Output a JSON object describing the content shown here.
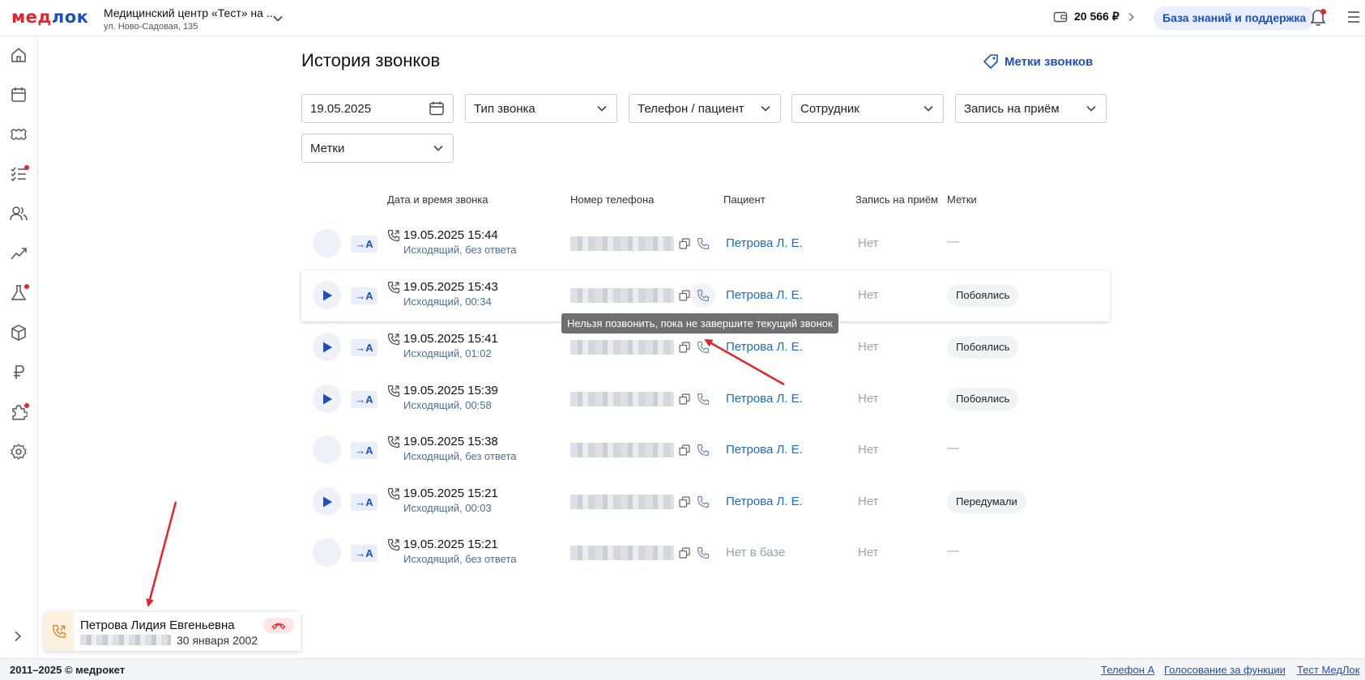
{
  "header": {
    "logo_red": "мед",
    "logo_blue": "лок",
    "clinic_name": "Медицинский центр «Тест» на ...",
    "clinic_address": "ул. Ново-Садовая, 135",
    "balance": "20 566 ₽",
    "kb_button": "База знаний и поддержка"
  },
  "sidebar": {
    "icons": [
      "home-icon",
      "calendar-icon",
      "teeth-icon",
      "tasks-icon",
      "people-icon",
      "chart-icon",
      "flask-icon",
      "box-icon",
      "ruble-icon",
      "puzzle-icon",
      "settings-icon"
    ],
    "notification_color": "#e3262d"
  },
  "page": {
    "title": "История звонков",
    "tags_link": "Метки звонков"
  },
  "filters": {
    "date": "19.05.2025",
    "call_type": "Тип звонка",
    "phone_patient": "Телефон / пациент",
    "employee": "Сотрудник",
    "appointment": "Запись на приём",
    "tags": "Метки"
  },
  "columns": [
    "Дата и время звонка",
    "Номер телефона",
    "Пациент",
    "Запись на приём",
    "Метки"
  ],
  "calls": [
    {
      "dir": "→A",
      "datetime": "19.05.2025 15:44",
      "sub": "Исходящий, без ответа",
      "patient": "Петрова Л. Е.",
      "appointment": "Нет",
      "tag": "—",
      "has_record": false
    },
    {
      "dir": "→A",
      "datetime": "19.05.2025 15:43",
      "sub": "Исходящий, 00:34",
      "patient": "Петрова Л. Е.",
      "appointment": "Нет",
      "tag": "Побоялись",
      "has_record": true
    },
    {
      "dir": "→A",
      "datetime": "19.05.2025 15:41",
      "sub": "Исходящий, 01:02",
      "patient": "Петрова Л. Е.",
      "appointment": "Нет",
      "tag": "Побоялись",
      "has_record": true
    },
    {
      "dir": "→A",
      "datetime": "19.05.2025 15:39",
      "sub": "Исходящий, 00:58",
      "patient": "Петрова Л. Е.",
      "appointment": "Нет",
      "tag": "Побоялись",
      "has_record": true
    },
    {
      "dir": "→A",
      "datetime": "19.05.2025 15:38",
      "sub": "Исходящий, без ответа",
      "patient": "Петрова Л. Е.",
      "appointment": "Нет",
      "tag": "—",
      "has_record": false
    },
    {
      "dir": "→A",
      "datetime": "19.05.2025 15:21",
      "sub": "Исходящий, 00:03",
      "patient": "Петрова Л. Е.",
      "appointment": "Нет",
      "tag": "Передумали",
      "has_record": true
    },
    {
      "dir": "→A",
      "datetime": "19.05.2025 15:21",
      "sub": "Исходящий, без ответа",
      "patient": "Нет в базе",
      "appointment": "Нет",
      "tag": "—",
      "has_record": false
    }
  ],
  "tooltip": "Нельзя позвонить, пока не завершите текущий звонок",
  "active_call": {
    "name": "Петрова Лидия Евгеньевна",
    "birth_date": "30 января 2002"
  },
  "footer": {
    "copyright": "2011–2025 © медрокет",
    "links": [
      "Телефон А",
      "Голосование за функции",
      "Тест МедЛок"
    ]
  },
  "colors": {
    "accent": "#1d4fc2",
    "link": "#1d6ad0",
    "danger": "#e3262d",
    "annotation_arrow": "#e8242a"
  }
}
